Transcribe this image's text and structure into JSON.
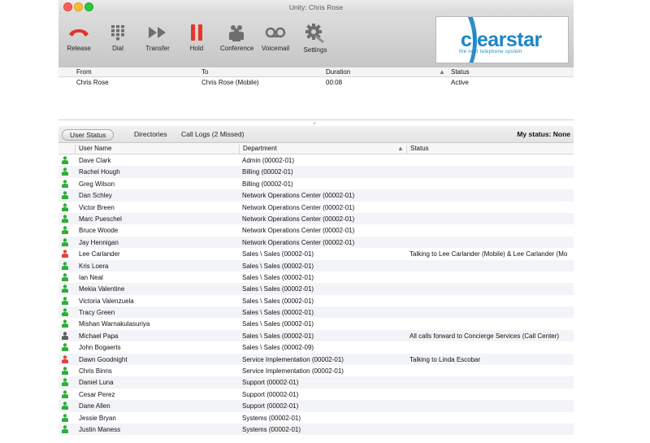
{
  "window": {
    "title": "Unity: Chris Rose"
  },
  "toolbar": {
    "buttons": [
      {
        "label": "Release",
        "icon": "phone-release-icon"
      },
      {
        "label": "Dial",
        "icon": "keypad-icon"
      },
      {
        "label": "Transfer",
        "icon": "transfer-icon"
      },
      {
        "label": "Hold",
        "icon": "pause-icon"
      },
      {
        "label": "Conference",
        "icon": "conference-icon"
      },
      {
        "label": "Voicemail",
        "icon": "voicemail-icon"
      },
      {
        "label": "Settings",
        "icon": "gear-icon"
      }
    ]
  },
  "logo": {
    "name": "clearstar",
    "tagline": "the next telephone system"
  },
  "calls": {
    "columns": [
      "From",
      "To",
      "Duration",
      "Status"
    ],
    "rows": [
      {
        "from": "Chris Rose",
        "to": "Chris Rose (Mobile)",
        "duration": "00:08",
        "status": "Active"
      }
    ]
  },
  "tabs": {
    "user_status": "User Status",
    "directories": "Directories",
    "call_logs": "Call Logs (2 Missed)",
    "my_status": "My status: None"
  },
  "users": {
    "columns": [
      "User Name",
      "Department",
      "Status"
    ],
    "rows": [
      {
        "name": "Dave Clark",
        "department": "Admin (00002-01)",
        "status": "",
        "presence": "available"
      },
      {
        "name": "Rachel Hough",
        "department": "Billing (00002-01)",
        "status": "",
        "presence": "available"
      },
      {
        "name": "Greg Wilson",
        "department": "Billing (00002-01)",
        "status": "",
        "presence": "available"
      },
      {
        "name": "Dan Schley",
        "department": "Network Operations Center (00002-01)",
        "status": "",
        "presence": "available"
      },
      {
        "name": "Victor Breen",
        "department": "Network Operations Center (00002-01)",
        "status": "",
        "presence": "available"
      },
      {
        "name": "Marc Pueschel",
        "department": "Network Operations Center (00002-01)",
        "status": "",
        "presence": "available"
      },
      {
        "name": "Bruce Woode",
        "department": "Network Operations Center (00002-01)",
        "status": "",
        "presence": "available"
      },
      {
        "name": "Jay Hennigan",
        "department": "Network Operations Center (00002-01)",
        "status": "",
        "presence": "available"
      },
      {
        "name": "Lee Carlander",
        "department": "Sales \\ Sales (00002-01)",
        "status": "Talking to Lee Carlander (Mobile) & Lee Carlander (Mo",
        "presence": "busy"
      },
      {
        "name": "Kris Loera",
        "department": "Sales \\ Sales (00002-01)",
        "status": "",
        "presence": "available"
      },
      {
        "name": "Ian Neal",
        "department": "Sales \\ Sales (00002-01)",
        "status": "",
        "presence": "available"
      },
      {
        "name": "Mekia Valentine",
        "department": "Sales \\ Sales (00002-01)",
        "status": "",
        "presence": "available"
      },
      {
        "name": "Victoria Valenzuela",
        "department": "Sales \\ Sales (00002-01)",
        "status": "",
        "presence": "available"
      },
      {
        "name": "Tracy Green",
        "department": "Sales \\ Sales (00002-01)",
        "status": "",
        "presence": "available"
      },
      {
        "name": "Mishan Warnakulasuriya",
        "department": "Sales \\ Sales (00002-01)",
        "status": "",
        "presence": "available"
      },
      {
        "name": "Michael Papa",
        "department": "Sales \\ Sales (00002-01)",
        "status": "All calls forward to Concierge Services (Call Center)",
        "presence": "forwarded"
      },
      {
        "name": "John Bogaerts",
        "department": "Sales \\ Sales (00002-09)",
        "status": "",
        "presence": "available"
      },
      {
        "name": "Dawn Goodnight",
        "department": "Service Implementation (00002-01)",
        "status": "Talking to Linda Escobar",
        "presence": "busy"
      },
      {
        "name": "Chris Binns",
        "department": "Service Implementation (00002-01)",
        "status": "",
        "presence": "available"
      },
      {
        "name": "Daniel Luna",
        "department": "Support (00002-01)",
        "status": "",
        "presence": "available"
      },
      {
        "name": "Cesar Perez",
        "department": "Support (00002-01)",
        "status": "",
        "presence": "available"
      },
      {
        "name": "Dane Allen",
        "department": "Support (00002-01)",
        "status": "",
        "presence": "available"
      },
      {
        "name": "Jessie Bryan",
        "department": "Systems (00002-01)",
        "status": "",
        "presence": "available"
      },
      {
        "name": "Justin Maness",
        "department": "Systems (00002-01)",
        "status": "",
        "presence": "available"
      }
    ]
  },
  "colors": {
    "available": "#2fae3a",
    "busy": "#e0463e",
    "forwarded": "#5d5d5d",
    "release": "#e0352b",
    "hold": "#e8352b",
    "toolbar_icon": "#6e6e6e",
    "brand": "#1b86c8"
  }
}
